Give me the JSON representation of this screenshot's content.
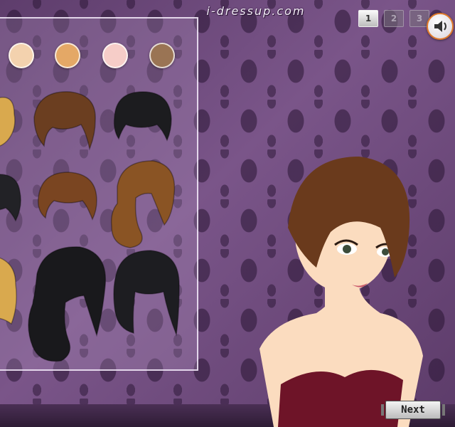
{
  "logo": {
    "text": "i-dressup.com"
  },
  "pager": {
    "pages": [
      {
        "label": "1",
        "active": true
      },
      {
        "label": "2",
        "active": false
      },
      {
        "label": "3",
        "active": false
      }
    ]
  },
  "sound": {
    "icon": "speaker-icon"
  },
  "skin_tones": [
    {
      "name": "fair",
      "color": "#f3d2ae"
    },
    {
      "name": "tan",
      "color": "#e4a866"
    },
    {
      "name": "rosy",
      "color": "#f6cdc8"
    },
    {
      "name": "brown",
      "color": "#9a7454"
    }
  ],
  "hairstyles": [
    {
      "name": "blonde-curly-partial-1",
      "color": "#d9a94e"
    },
    {
      "name": "brown-short-swept",
      "color": "#6b3e20"
    },
    {
      "name": "black-short-pixie",
      "color": "#1c1c1f"
    },
    {
      "name": "black-wavy-partial",
      "color": "#222226"
    },
    {
      "name": "brown-short-bob",
      "color": "#7a4521"
    },
    {
      "name": "caramel-long-wavy",
      "color": "#8a5424"
    },
    {
      "name": "blonde-curly-partial-2",
      "color": "#d9a94e"
    },
    {
      "name": "black-long-curly",
      "color": "#19191c"
    },
    {
      "name": "black-long-wavy",
      "color": "#1d1d21"
    }
  ],
  "model": {
    "hair_color": "#6a3a1c",
    "skin_color": "#fbdcbf",
    "top_color": "#6e1428"
  },
  "next_button": {
    "label": "Next"
  }
}
